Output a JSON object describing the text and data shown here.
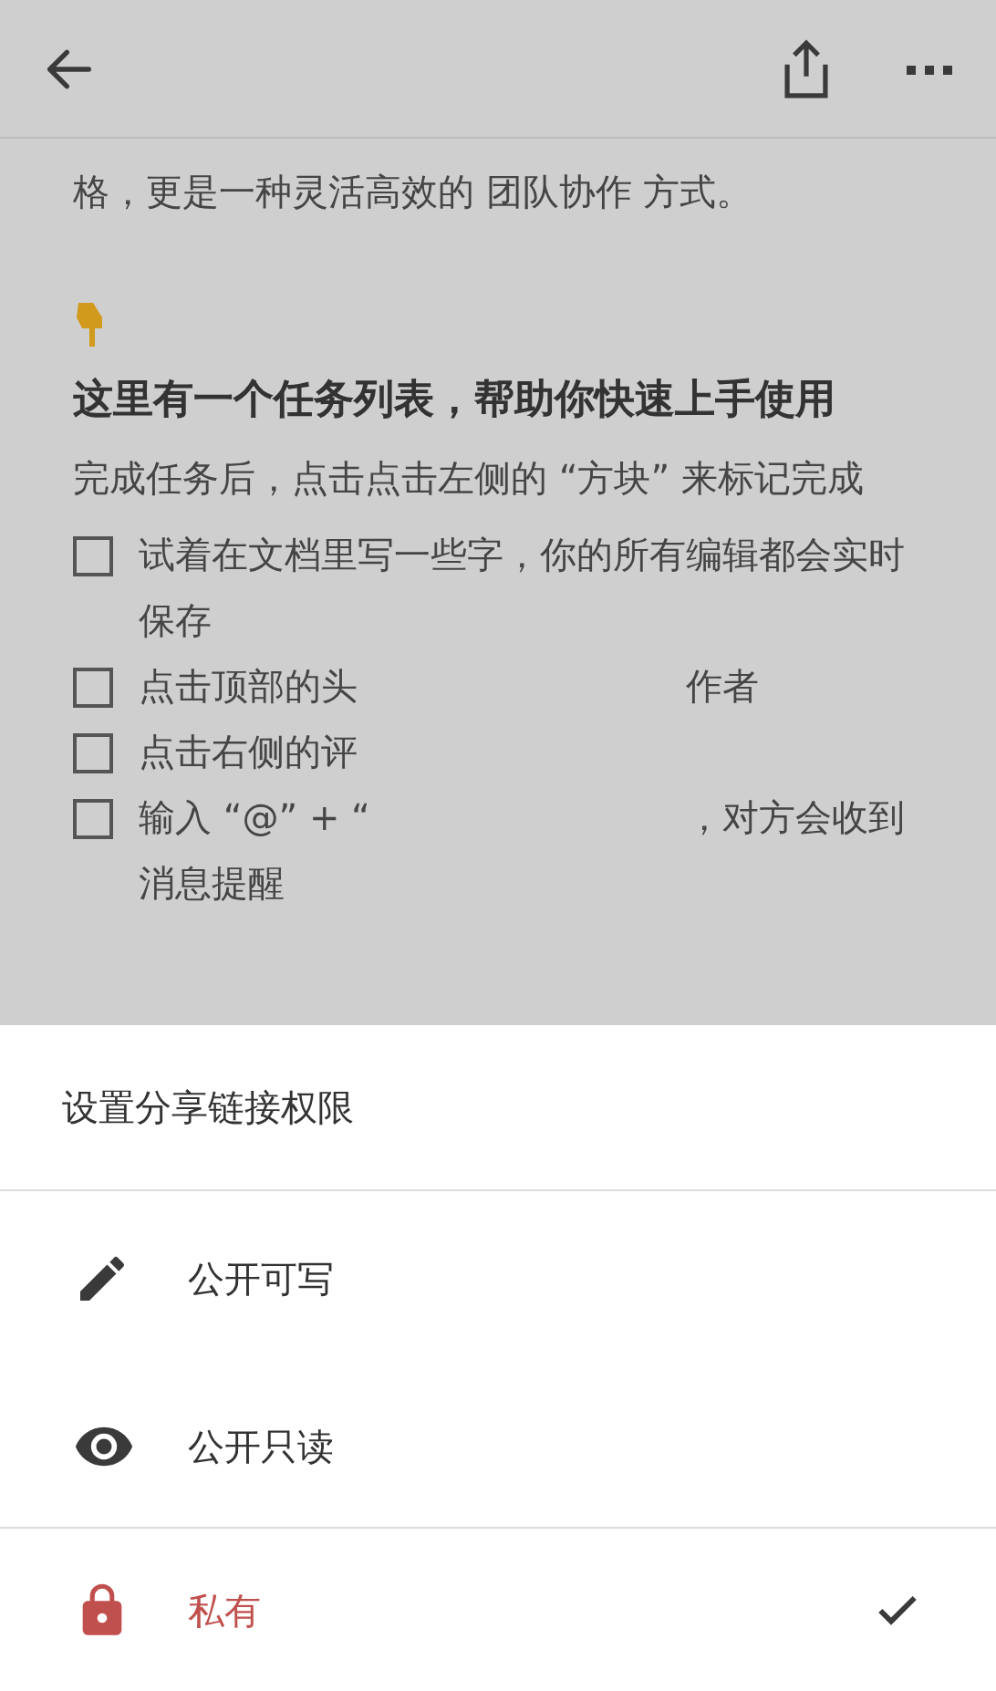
{
  "document": {
    "intro_tail": "格，更是一种灵活高效的 团队协作 方式。",
    "heading": "这里有一个任务列表，帮助你快速上手使用",
    "paragraph": "完成任务后，点击点击左侧的 “方块” 来标记完成",
    "tasks": [
      {
        "text": "试着在文档里写一些字，你的所有编辑都会实时保存",
        "checked": false
      },
      {
        "text": "点击顶部的头",
        "text_after": "作者",
        "checked": false
      },
      {
        "text": "点击右侧的评",
        "checked": false
      },
      {
        "text": "输入 “@” + “",
        "text_after": "，对方会收到",
        "text_next_line": "消息提醒",
        "checked": false
      }
    ]
  },
  "share_sheet": {
    "title": "设置分享链接权限",
    "options": [
      {
        "kind": "write",
        "label": "公开可写",
        "selected": false
      },
      {
        "kind": "read",
        "label": "公开只读",
        "selected": false
      },
      {
        "kind": "private",
        "label": "私有",
        "selected": true
      }
    ]
  }
}
